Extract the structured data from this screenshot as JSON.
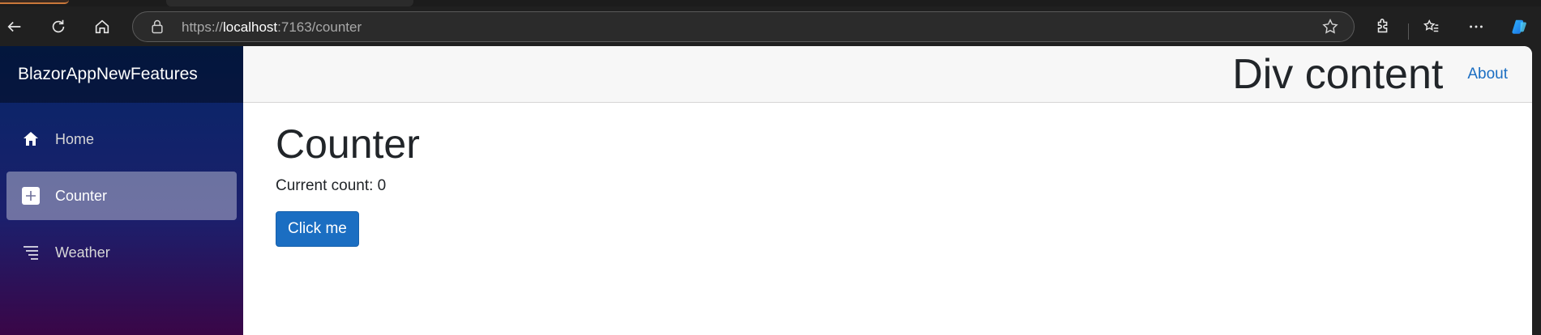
{
  "browser": {
    "url_scheme": "https://",
    "url_host": "localhost",
    "url_rest": ":7163/counter"
  },
  "sidebar": {
    "brand": "BlazorAppNewFeatures",
    "items": [
      {
        "label": "Home",
        "icon": "house-icon",
        "active": false
      },
      {
        "label": "Counter",
        "icon": "plus-square-icon",
        "active": true
      },
      {
        "label": "Weather",
        "icon": "list-icon",
        "active": false
      }
    ]
  },
  "top_row": {
    "div_content": "Div content",
    "about_label": "About"
  },
  "page": {
    "title": "Counter",
    "count_text": "Current count: 0",
    "button_label": "Click me"
  },
  "colors": {
    "accent": "#1b6ec2",
    "sidebar_top": "#052767",
    "sidebar_bottom": "#3a0647"
  }
}
